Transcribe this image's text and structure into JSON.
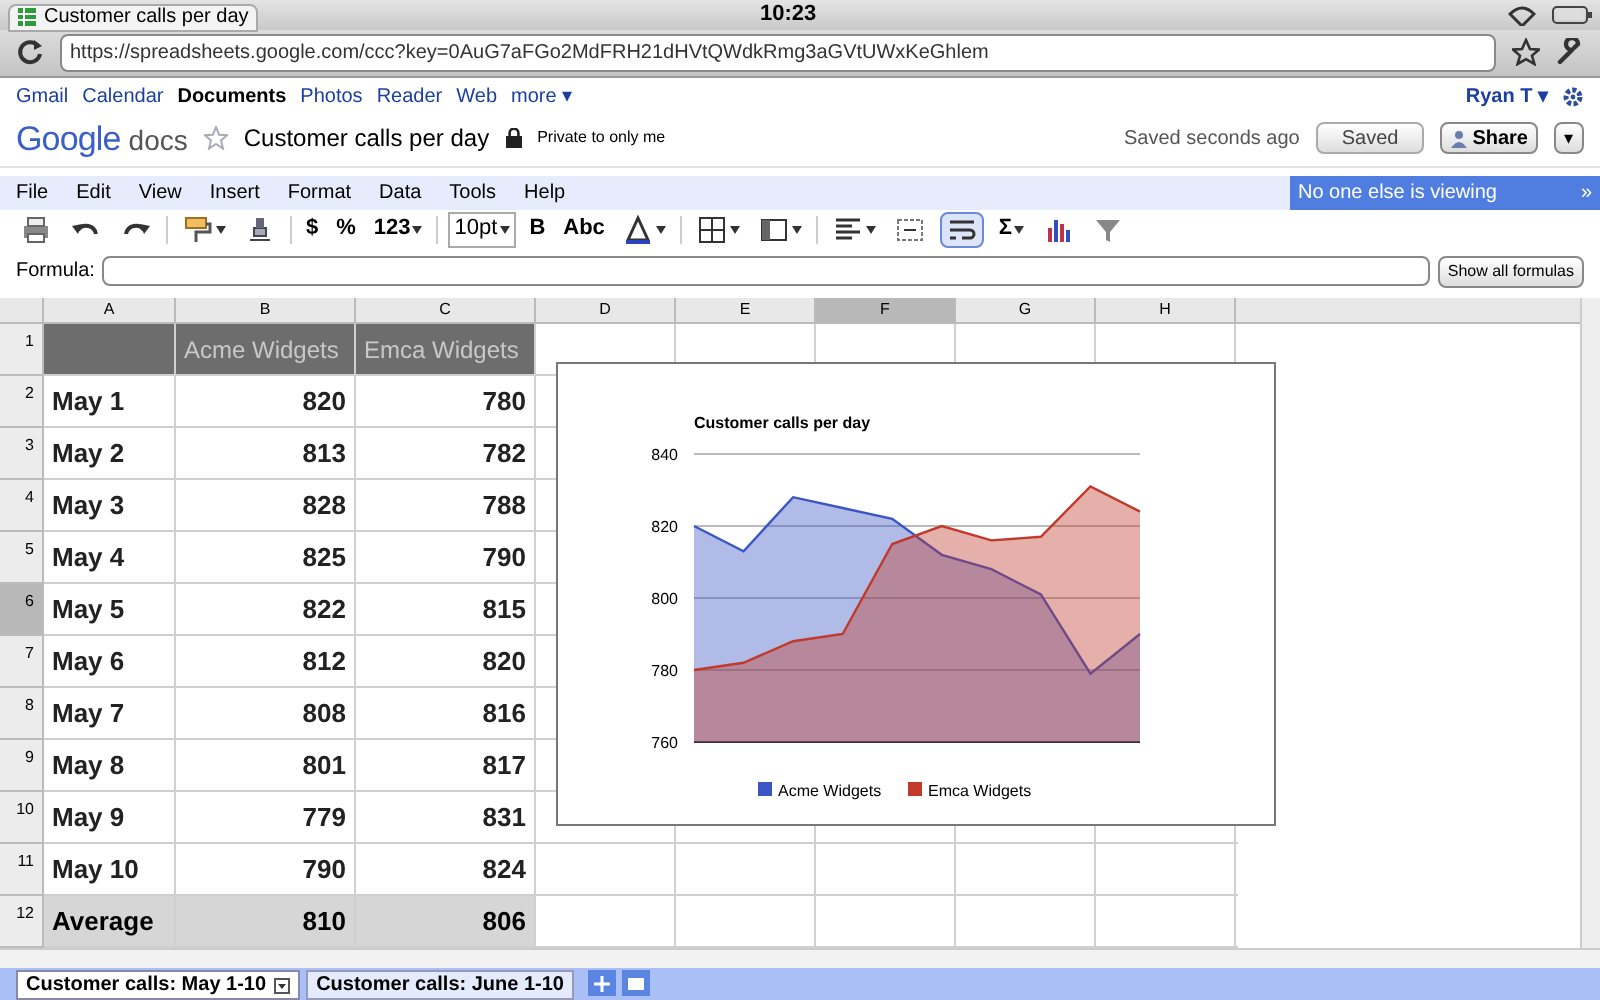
{
  "status_bar": {
    "tab_title": "Customer calls per day",
    "time": "10:23"
  },
  "browser": {
    "url": "https://spreadsheets.google.com/ccc?key=0AuG7aFGo2MdFRH21dHVtQWdkRmg3aGVtUWxKeGhlem"
  },
  "google_bar": {
    "links": [
      {
        "label": "Gmail",
        "selected": false
      },
      {
        "label": "Calendar",
        "selected": false
      },
      {
        "label": "Documents",
        "selected": true
      },
      {
        "label": "Photos",
        "selected": false
      },
      {
        "label": "Reader",
        "selected": false
      },
      {
        "label": "Web",
        "selected": false
      },
      {
        "label": "more ▾",
        "selected": false
      }
    ],
    "user": "Ryan T ▾"
  },
  "doc": {
    "logo_google": "Google",
    "logo_docs": "docs",
    "title": "Customer calls per day",
    "privacy": "Private to only me",
    "save_status": "Saved seconds ago",
    "saved_button": "Saved",
    "share_button": "Share",
    "share_menu": "▾"
  },
  "menu": [
    "File",
    "Edit",
    "View",
    "Insert",
    "Format",
    "Data",
    "Tools",
    "Help"
  ],
  "viewers": {
    "text": "No one else is viewing",
    "toggle": "»"
  },
  "toolbar": [
    {
      "kind": "icon",
      "menu": false,
      "selected": false
    },
    {
      "kind": "icon",
      "menu": false,
      "selected": false
    },
    {
      "kind": "icon",
      "menu": false,
      "selected": false
    },
    {
      "kind": "sep"
    },
    {
      "kind": "icon",
      "menu": true,
      "selected": false
    },
    {
      "kind": "icon",
      "menu": false,
      "selected": false
    },
    {
      "kind": "sep"
    },
    {
      "kind": "text",
      "label": "$",
      "menu": false,
      "selected": false
    },
    {
      "kind": "text",
      "label": "%",
      "menu": false,
      "selected": false
    },
    {
      "kind": "text",
      "label": "123",
      "menu": true,
      "selected": false
    },
    {
      "kind": "sep"
    },
    {
      "kind": "box",
      "label": "10pt",
      "menu": true,
      "selected": false
    },
    {
      "kind": "text",
      "label": "B",
      "menu": false,
      "selected": false
    },
    {
      "kind": "text",
      "label": "Abc",
      "menu": false,
      "selected": false
    },
    {
      "kind": "icon",
      "menu": true,
      "selected": false
    },
    {
      "kind": "sep"
    },
    {
      "kind": "icon",
      "menu": true,
      "selected": false
    },
    {
      "kind": "icon",
      "menu": true,
      "selected": false
    },
    {
      "kind": "sep"
    },
    {
      "kind": "icon",
      "menu": true,
      "selected": false
    },
    {
      "kind": "icon",
      "menu": false,
      "selected": false
    },
    {
      "kind": "icon",
      "menu": false,
      "selected": true
    },
    {
      "kind": "text",
      "label": "Σ",
      "menu": true,
      "selected": false
    },
    {
      "kind": "icon",
      "menu": false,
      "selected": false
    },
    {
      "kind": "icon",
      "menu": false,
      "selected": false
    }
  ],
  "formula_bar": {
    "label": "Formula:",
    "show_button": "Show all formulas"
  },
  "grid": {
    "columns": [
      {
        "label": "A",
        "selected": false
      },
      {
        "label": "B",
        "selected": false
      },
      {
        "label": "C",
        "selected": false
      },
      {
        "label": "D",
        "selected": false
      },
      {
        "label": "E",
        "selected": false
      },
      {
        "label": "F",
        "selected": true
      },
      {
        "label": "G",
        "selected": false
      },
      {
        "label": "H",
        "selected": false
      }
    ],
    "rows": [
      {
        "number": "1",
        "kind": "header",
        "selected": false,
        "cells": [
          "",
          "Acme Widgets",
          "Emca Widgets"
        ]
      },
      {
        "number": "2",
        "kind": "data",
        "selected": false,
        "cells": [
          "May 1",
          "820",
          "780"
        ]
      },
      {
        "number": "3",
        "kind": "data",
        "selected": false,
        "cells": [
          "May 2",
          "813",
          "782"
        ]
      },
      {
        "number": "4",
        "kind": "data",
        "selected": false,
        "cells": [
          "May 3",
          "828",
          "788"
        ]
      },
      {
        "number": "5",
        "kind": "data",
        "selected": false,
        "cells": [
          "May 4",
          "825",
          "790"
        ]
      },
      {
        "number": "6",
        "kind": "data",
        "selected": true,
        "cells": [
          "May 5",
          "822",
          "815"
        ]
      },
      {
        "number": "7",
        "kind": "data",
        "selected": false,
        "cells": [
          "May 6",
          "812",
          "820"
        ]
      },
      {
        "number": "8",
        "kind": "data",
        "selected": false,
        "cells": [
          "May 7",
          "808",
          "816"
        ]
      },
      {
        "number": "9",
        "kind": "data",
        "selected": false,
        "cells": [
          "May 8",
          "801",
          "817"
        ]
      },
      {
        "number": "10",
        "kind": "data",
        "selected": false,
        "cells": [
          "May 9",
          "779",
          "831"
        ]
      },
      {
        "number": "11",
        "kind": "data",
        "selected": false,
        "cells": [
          "May 10",
          "790",
          "824"
        ]
      },
      {
        "number": "12",
        "kind": "total",
        "selected": false,
        "cells": [
          "Average",
          "810",
          "806"
        ]
      }
    ],
    "chart_data": {
      "type": "area",
      "title": "Customer calls per day",
      "series": [
        {
          "name": "Acme Widgets",
          "color": "#3b56c4",
          "values": [
            820,
            813,
            828,
            825,
            822,
            812,
            808,
            801,
            779,
            790
          ]
        },
        {
          "name": "Emca Widgets",
          "color": "#c0392b",
          "values": [
            780,
            782,
            788,
            790,
            815,
            820,
            816,
            817,
            831,
            824
          ]
        }
      ],
      "ylim": [
        760,
        840
      ],
      "yticks": [
        760,
        780,
        800,
        820,
        840
      ],
      "grid": true,
      "legend": "bottom"
    }
  },
  "sheet_tabs": [
    {
      "label": "Customer calls: May 1-10",
      "selected": true
    },
    {
      "label": "Customer calls: June 1-10",
      "selected": false
    }
  ]
}
